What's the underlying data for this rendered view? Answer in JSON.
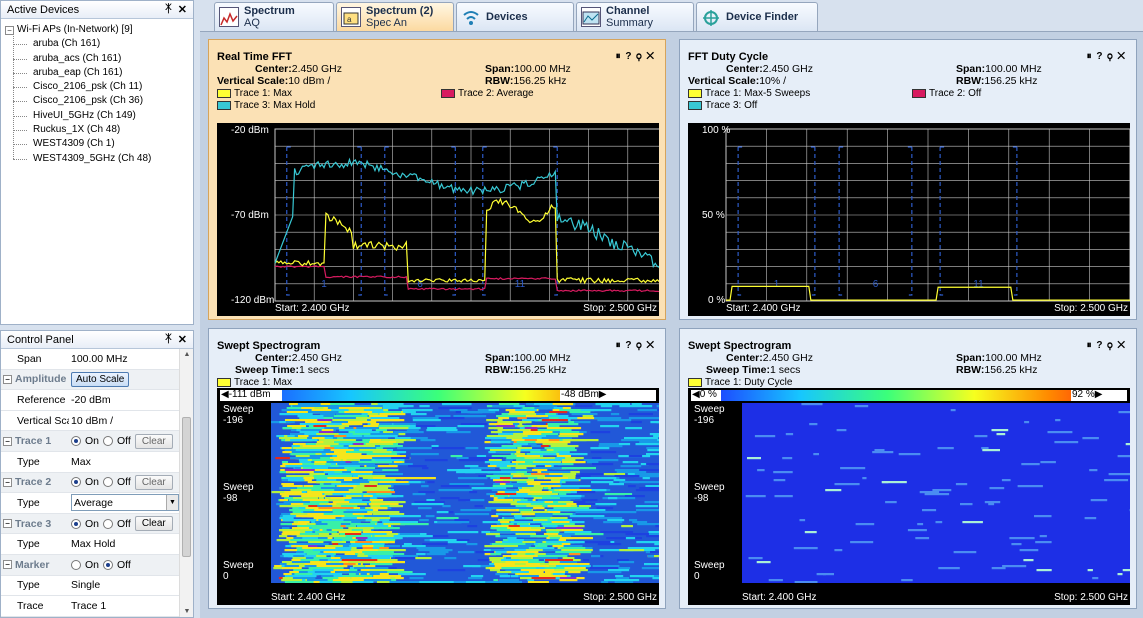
{
  "devices_panel": {
    "title": "Active Devices",
    "root": "Wi-Fi APs (In-Network) [9]",
    "items": [
      "aruba (Ch 161)",
      "aruba_acs (Ch 161)",
      "aruba_eap (Ch 161)",
      "Cisco_2106_psk (Ch 11)",
      "Cisco_2106_psk (Ch 36)",
      "HiveUI_5GHz (Ch 149)",
      "Ruckus_1X (Ch 48)",
      "WEST4309 (Ch 1)",
      "WEST4309_5GHz (Ch 48)"
    ]
  },
  "control_panel": {
    "title": "Control Panel",
    "span_label": "Span",
    "span_value": "100.00 MHz",
    "amplitude_label": "Amplitude",
    "autoscale_label": "Auto Scale",
    "reference_label": "Reference",
    "reference_value": "-20 dBm",
    "vscale_label": "Vertical Sca",
    "vscale_value": "10 dBm /",
    "trace1_label": "Trace 1",
    "trace1_type": "Max",
    "trace2_label": "Trace 2",
    "trace2_type": "Average",
    "trace3_label": "Trace 3",
    "trace3_type": "Max Hold",
    "marker_label": "Marker",
    "marker_type": "Single",
    "marker_trace": "Trace 1",
    "type_label": "Type",
    "trace_label": "Trace",
    "on_label": "On",
    "off_label": "Off",
    "clear_label": "Clear"
  },
  "tabs": [
    {
      "title": "Spectrum",
      "sub": "AQ"
    },
    {
      "title": "Spectrum (2)",
      "sub": "Spec An"
    },
    {
      "title": "Devices"
    },
    {
      "title": "Channel",
      "sub": "Summary"
    },
    {
      "title": "Device Finder"
    }
  ],
  "panels": {
    "fft": {
      "title": "Real Time FFT",
      "center_label": "Center:",
      "center": "2.450 GHz",
      "span_label": "Span:",
      "span": "100.00 MHz",
      "vscale_label": "Vertical Scale:",
      "vscale": "10 dBm /",
      "rbw_label": "RBW:",
      "rbw": "156.25 kHz",
      "trace1": "Trace 1: Max",
      "trace2": "Trace 2: Average",
      "trace3": "Trace 3: Max Hold",
      "y_top": "-20 dBm",
      "y_mid": "-70 dBm",
      "y_bot": "-120 dBm",
      "start": "Start: 2.400 GHz",
      "stop": "Stop: 2.500 GHz",
      "ch1": "1",
      "ch6": "6",
      "ch11": "11"
    },
    "duty": {
      "title": "FFT Duty Cycle",
      "center_label": "Center:",
      "center": "2.450 GHz",
      "span_label": "Span:",
      "span": "100.00 MHz",
      "vscale_label": "Vertical Scale:",
      "vscale": "10% /",
      "rbw_label": "RBW:",
      "rbw": "156.25 kHz",
      "trace1": "Trace 1: Max-5 Sweeps",
      "trace2": "Trace 2: Off",
      "trace3": "Trace 3: Off",
      "y_top": "100 %",
      "y_mid": "50 %",
      "y_bot": "0 %",
      "start": "Start: 2.400 GHz",
      "stop": "Stop: 2.500 GHz",
      "ch1": "1",
      "ch6": "6",
      "ch11": "11"
    },
    "spectro1": {
      "title": "Swept Spectrogram",
      "center_label": "Center:",
      "center": "2.450 GHz",
      "span_label": "Span:",
      "span": "100.00 MHz",
      "sweep_label": "Sweep Time:",
      "sweep": "1 secs",
      "rbw_label": "RBW:",
      "rbw": "156.25 kHz",
      "trace1": "Trace 1: Max",
      "cb_min": "-111 dBm",
      "cb_max": "-48 dBm",
      "sweep_label_text": "Sweep",
      "s_top": "-196",
      "s_mid": "-98",
      "s_bot": "0",
      "start": "Start: 2.400 GHz",
      "stop": "Stop: 2.500 GHz"
    },
    "spectro2": {
      "title": "Swept Spectrogram",
      "center_label": "Center:",
      "center": "2.450 GHz",
      "span_label": "Span:",
      "span": "100.00 MHz",
      "sweep_label": "Sweep Time:",
      "sweep": "1 secs",
      "rbw_label": "RBW:",
      "rbw": "156.25 kHz",
      "trace1": "Trace 1: Duty Cycle",
      "cb_min": "0 %",
      "cb_max": "92 %",
      "sweep_label_text": "Sweep",
      "s_top": "-196",
      "s_mid": "-98",
      "s_bot": "0",
      "start": "Start: 2.400 GHz",
      "stop": "Stop: 2.500 GHz"
    }
  },
  "colors": {
    "trace_max": "#ffff33",
    "trace_avg": "#d81b60",
    "trace_hold": "#38c8d4",
    "grid": "#c8c8c8",
    "channel_marker": "#2d5bc9"
  }
}
